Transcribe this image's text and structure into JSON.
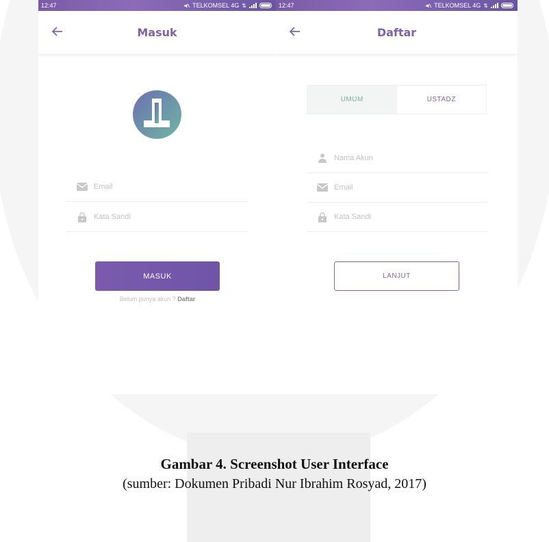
{
  "statusbar": {
    "time": "12:47",
    "carrier": "TELKOMSEL 4G"
  },
  "login_screen": {
    "title": "Masuk",
    "email_placeholder": "Email",
    "password_placeholder": "Kata Sandi",
    "submit_label": "MASUK",
    "register_prompt": "Belum punya akun ?",
    "register_link": "Daftar"
  },
  "register_screen": {
    "title": "Daftar",
    "tabs": [
      {
        "label": "UMUM",
        "active": true
      },
      {
        "label": "USTADZ",
        "active": false
      }
    ],
    "name_placeholder": "Nama Akun",
    "email_placeholder": "Email",
    "password_placeholder": "Kata Sandi",
    "next_label": "LANJUT"
  },
  "caption": {
    "title": "Gambar 4. Screenshot User Interface",
    "source": "(sumber: Dokumen Pribadi Nur Ibrahim Rosyad, 2017)"
  },
  "colors": {
    "accent": "#7d62b2",
    "teal": "#74b09a",
    "statusbar": "#7b5aa6"
  }
}
